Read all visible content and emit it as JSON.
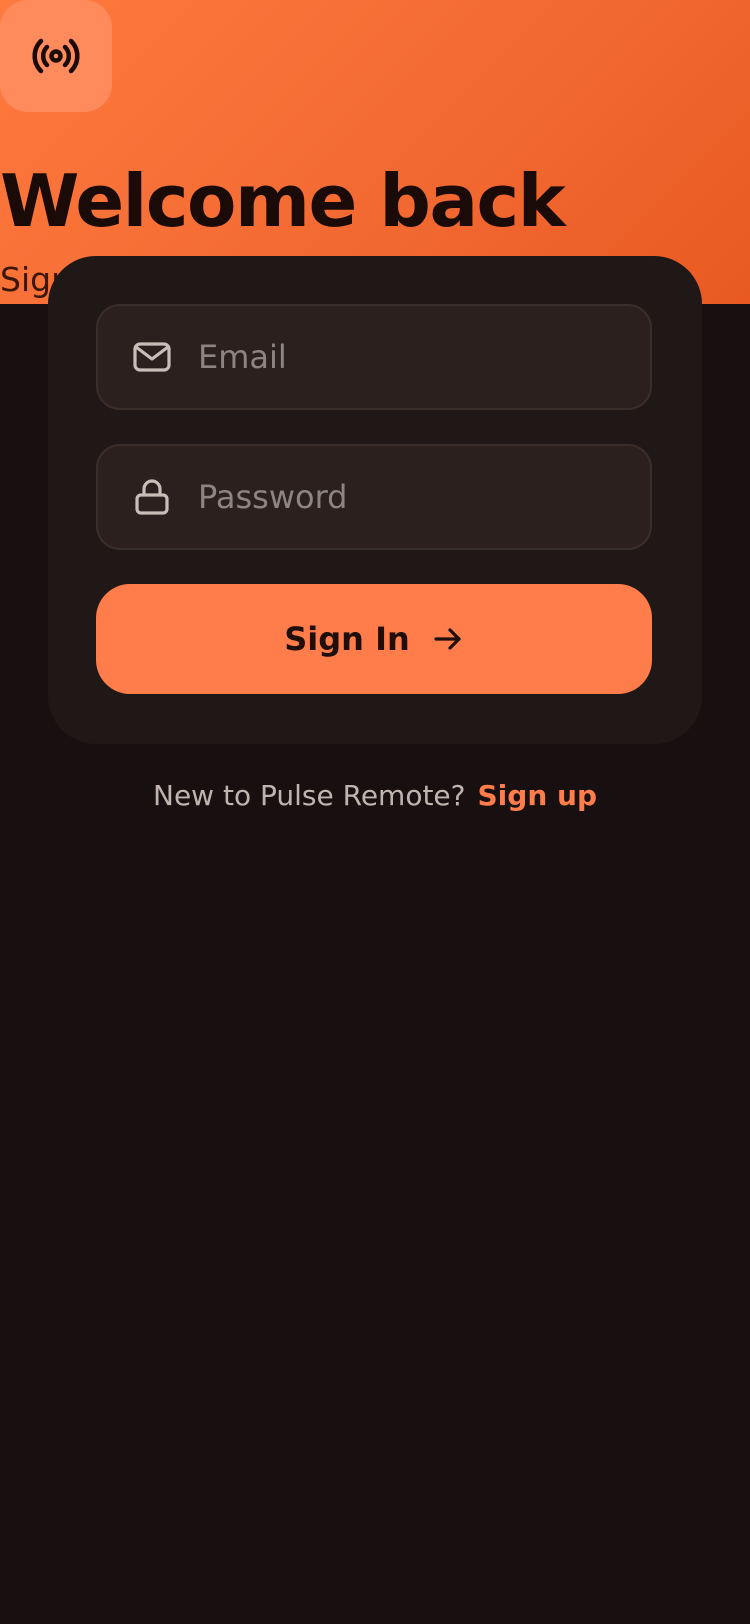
{
  "colors": {
    "accent": "#ff7c4b",
    "hero_gradient_start": "#ff7a3f",
    "hero_gradient_end": "#e85a22",
    "background": "#181010",
    "card": "#201816",
    "field": "#2b201e",
    "title_text": "#1a0b08"
  },
  "header": {
    "logo_icon": "broadcast-signal-icon",
    "title": "Welcome back",
    "subtitle": "Sign"
  },
  "form": {
    "email": {
      "icon": "envelope-icon",
      "placeholder": "Email",
      "value": ""
    },
    "password": {
      "icon": "lock-icon",
      "placeholder": "Password",
      "value": ""
    },
    "submit": {
      "label": "Sign In",
      "icon": "arrow-right-icon"
    }
  },
  "footer": {
    "prompt": "New to Pulse Remote?",
    "link_label": "Sign up"
  }
}
